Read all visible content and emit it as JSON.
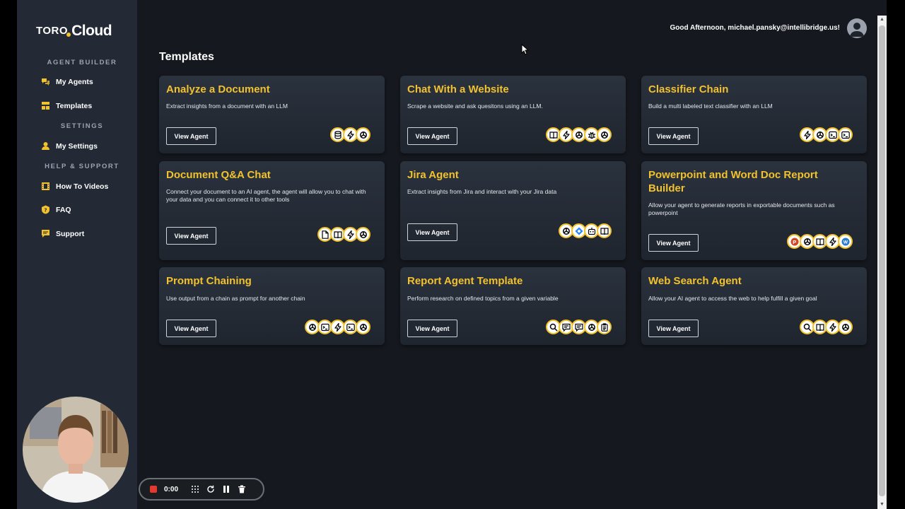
{
  "app": {
    "logo_left": "TORO",
    "logo_right": "Cloud"
  },
  "sidebar": {
    "sections": [
      {
        "title": "AGENT BUILDER",
        "items": [
          {
            "label": "My Agents",
            "icon": "chat-bubbles-icon"
          },
          {
            "label": "Templates",
            "icon": "templates-icon"
          }
        ]
      },
      {
        "title": "SETTINGS",
        "items": [
          {
            "label": "My Settings",
            "icon": "user-icon"
          }
        ]
      },
      {
        "title": "HELP & SUPPORT",
        "items": [
          {
            "label": "How To Videos",
            "icon": "film-icon"
          },
          {
            "label": "FAQ",
            "icon": "question-shield-icon"
          },
          {
            "label": "Support",
            "icon": "support-chat-icon"
          }
        ]
      }
    ]
  },
  "header": {
    "greeting": "Good Afternoon, michael.pansky@intellibridge.us!"
  },
  "main": {
    "title": "Templates",
    "view_label": "View Agent",
    "cards": [
      {
        "title": "Analyze a Document",
        "desc": "Extract insights from a document with an LLM",
        "icons": [
          "database-icon",
          "bolt-icon",
          "openai-icon"
        ]
      },
      {
        "title": "Chat With a Website",
        "desc": "Scrape a website and ask quesitons using an LLM.",
        "icons": [
          "book-icon",
          "bolt-icon",
          "openai-icon",
          "bug-icon",
          "openai-icon"
        ]
      },
      {
        "title": "Classifier Chain",
        "desc": "Build a multi labeled text classifier with an LLM",
        "icons": [
          "bolt-icon",
          "openai-icon",
          "terminal-icon",
          "terminal-icon"
        ]
      },
      {
        "title": "Document Q&A Chat",
        "desc": "Connect your document to an AI agent, the agent will allow you to chat with your data and you can connect it to other tools",
        "icons": [
          "document-icon",
          "book-icon",
          "bolt-icon",
          "openai-icon"
        ]
      },
      {
        "title": "Jira Agent",
        "desc": "Extract insights from Jira and interact with your Jira data",
        "icons": [
          "openai-icon",
          "jira-icon",
          "robot-icon",
          "book-icon"
        ]
      },
      {
        "title": "Powerpoint and Word Doc Report Builder",
        "desc": "Allow your agent to generate reports in exportable documents such as powerpoint",
        "icons": [
          "powerpoint-icon",
          "openai-icon",
          "book-icon",
          "bolt-icon",
          "word-icon"
        ]
      },
      {
        "title": "Prompt Chaining",
        "desc": "Use output from a chain as prompt for another chain",
        "icons": [
          "openai-icon",
          "terminal-icon",
          "bolt-icon",
          "terminal-icon",
          "openai-icon"
        ]
      },
      {
        "title": "Report Agent Template",
        "desc": "Perform research on defined topics from a given variable",
        "icons": [
          "search-icon",
          "prompt-icon",
          "prompt-icon",
          "openai-icon",
          "clipboard-icon"
        ]
      },
      {
        "title": "Web Search Agent",
        "desc": "Allow your AI agent to access the web to help fulfill a given goal",
        "icons": [
          "search-icon",
          "book-icon",
          "bolt-icon",
          "openai-icon"
        ]
      }
    ]
  },
  "recorder": {
    "time": "0:00"
  },
  "colors": {
    "accent": "#f2c12e",
    "sidebar": "#232a36",
    "background": "#15181e",
    "record": "#e4372e"
  }
}
